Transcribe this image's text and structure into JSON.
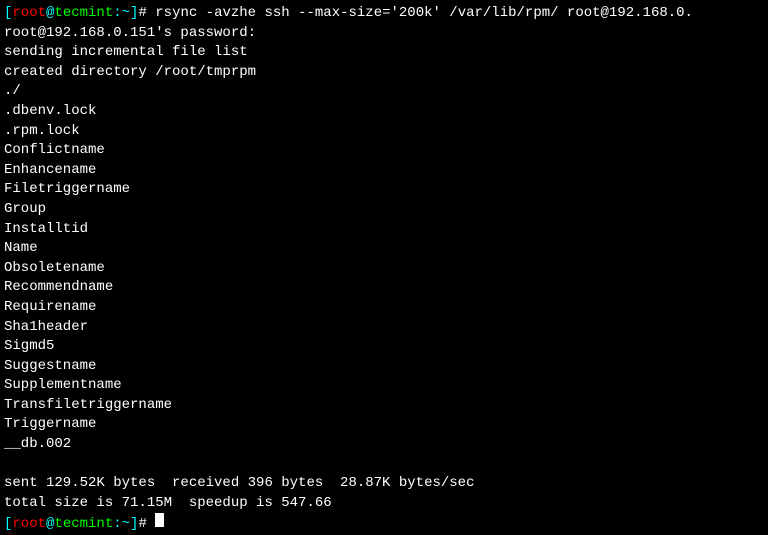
{
  "prompt1": {
    "bracket_open": "[",
    "user": "root",
    "at": "@",
    "host": "tecmint",
    "colon": ":",
    "path": "~",
    "bracket_close": "]",
    "hash": "#",
    "command": " rsync -avzhe ssh --max-size='200k' /var/lib/rpm/ root@192.168.0."
  },
  "output_lines": [
    "root@192.168.0.151's password:",
    "sending incremental file list",
    "created directory /root/tmprpm",
    "./",
    ".dbenv.lock",
    ".rpm.lock",
    "Conflictname",
    "Enhancename",
    "Filetriggername",
    "Group",
    "Installtid",
    "Name",
    "Obsoletename",
    "Recommendname",
    "Requirename",
    "Sha1header",
    "Sigmd5",
    "Suggestname",
    "Supplementname",
    "Transfiletriggername",
    "Triggername",
    "__db.002",
    "",
    "sent 129.52K bytes  received 396 bytes  28.87K bytes/sec",
    "total size is 71.15M  speedup is 547.66"
  ],
  "prompt2": {
    "bracket_open": "[",
    "user": "root",
    "at": "@",
    "host": "tecmint",
    "colon": ":",
    "path": "~",
    "bracket_close": "]",
    "hash": "#",
    "space": " "
  }
}
